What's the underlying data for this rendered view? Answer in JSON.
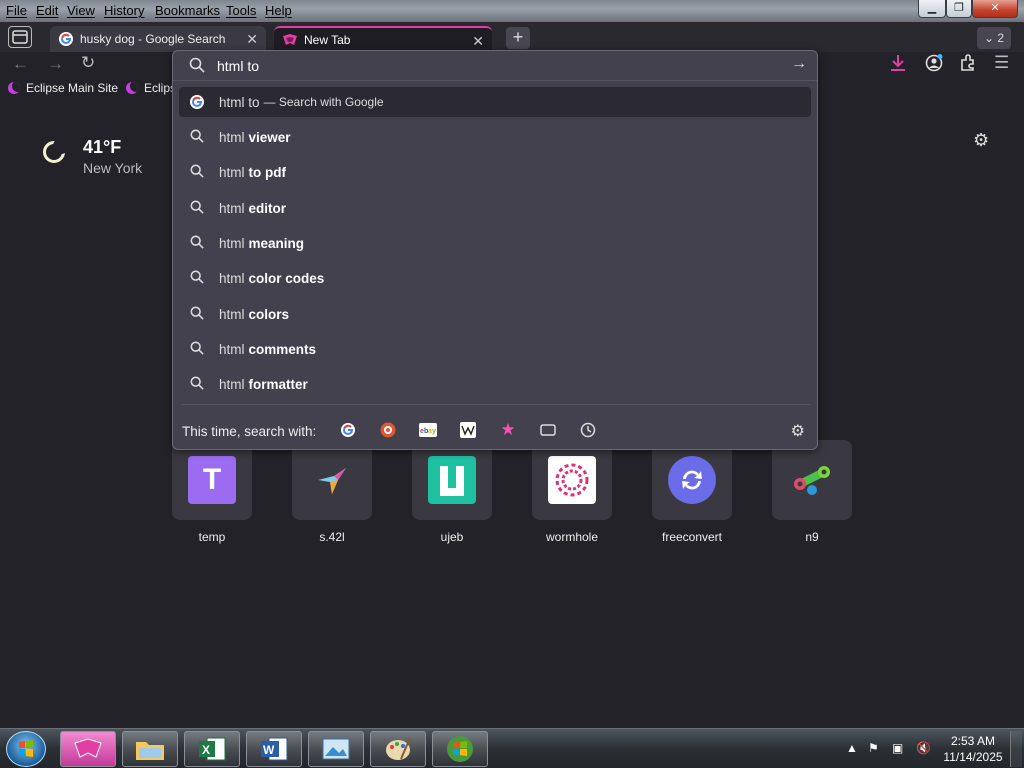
{
  "menubar": {
    "items": [
      "File",
      "Edit",
      "View",
      "History",
      "Bookmarks",
      "Tools",
      "Help"
    ]
  },
  "tabs": [
    {
      "title": "husky dog - Google Search",
      "icon": "google-icon"
    },
    {
      "title": "New Tab",
      "icon": "eclipse-logo-icon",
      "active": true
    }
  ],
  "tab_count": "2",
  "bookmarks": [
    "Eclipse Main Site",
    "Eclips"
  ],
  "weather": {
    "temp": "41°F",
    "city": "New York"
  },
  "url_bar": {
    "value": "html to",
    "first_hint": "— Search with Google"
  },
  "suggestions": [
    {
      "base": "html to",
      "bold": ""
    },
    {
      "base": "html",
      "bold": "viewer"
    },
    {
      "base": "html",
      "bold": "to pdf"
    },
    {
      "base": "html",
      "bold": "editor"
    },
    {
      "base": "html",
      "bold": "meaning"
    },
    {
      "base": "html",
      "bold": "color codes"
    },
    {
      "base": "html",
      "bold": "colors"
    },
    {
      "base": "html",
      "bold": "comments"
    },
    {
      "base": "html",
      "bold": "formatter"
    }
  ],
  "one_off": {
    "label": "This time, search with:",
    "engines": [
      "google-icon",
      "duckduckgo-icon",
      "ebay-icon",
      "wikipedia-icon",
      "bookmarks-star-icon",
      "tabs-icon",
      "history-icon"
    ]
  },
  "shortcuts": [
    {
      "label": "temp",
      "icon": "temp-logo-icon",
      "color": "#9b6cf0"
    },
    {
      "label": "s.42l",
      "icon": "hummingbird-icon",
      "color": "#3a3941"
    },
    {
      "label": "ujeb",
      "icon": "ujeb-logo-icon",
      "color": "#1fc0a0"
    },
    {
      "label": "wormhole",
      "icon": "wormhole-logo-icon",
      "color": "#ffffff"
    },
    {
      "label": "freeconvert",
      "icon": "freeconvert-logo-icon",
      "color": "#6a6ce8"
    },
    {
      "label": "n9",
      "icon": "n9-logo-icon",
      "color": "#3a3941"
    }
  ],
  "clock": {
    "time": "2:53 AM",
    "date": "11/14/2025"
  },
  "colors": {
    "accent": "#e13fa4",
    "panel": "#42414d",
    "page_bg": "#232228"
  }
}
